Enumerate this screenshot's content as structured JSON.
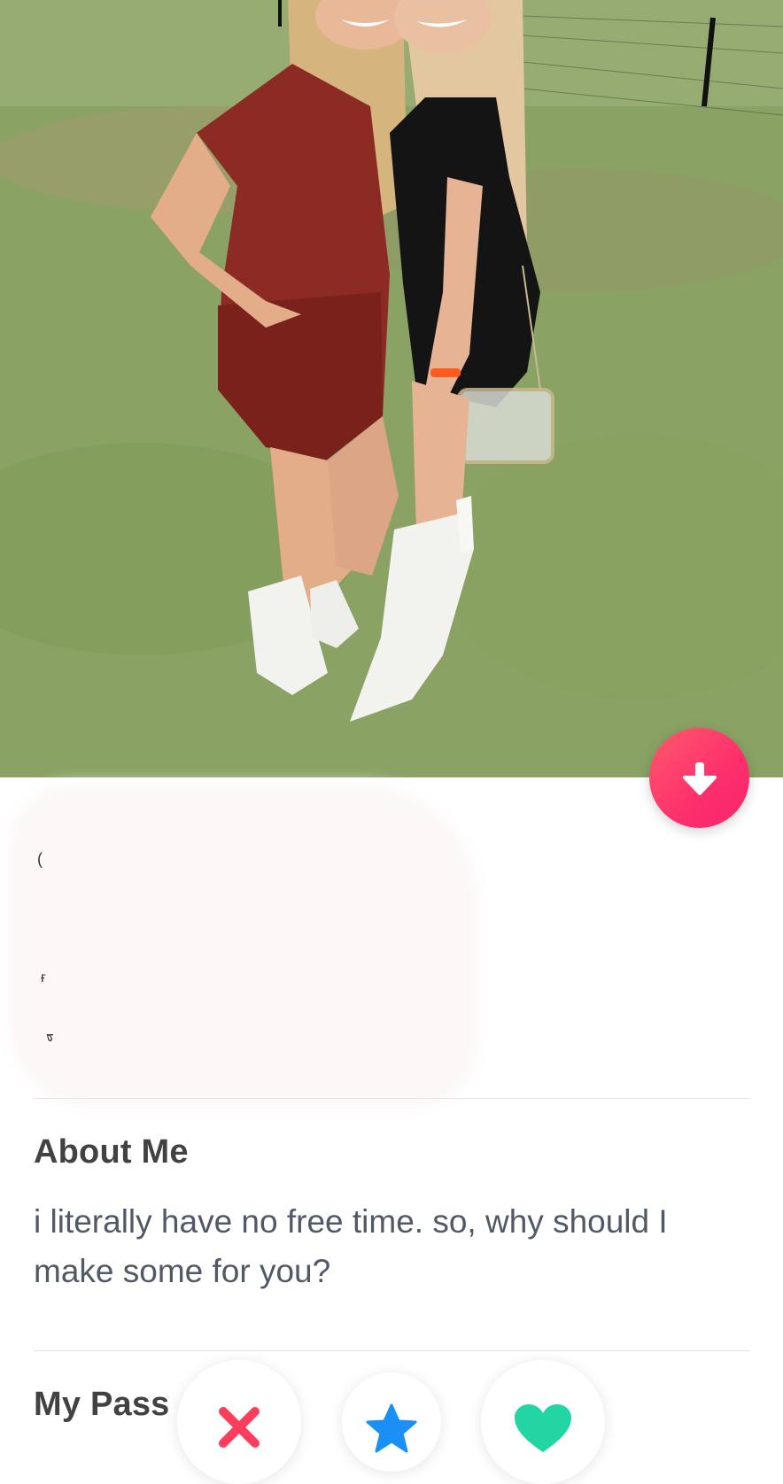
{
  "profile_photo": {
    "description_icon": "profile-photo",
    "accent_colors": {
      "outfit_left": "#8c2a24",
      "outfit_right": "#141414",
      "boots": "#f2f2ef",
      "grass": "#8aa264"
    }
  },
  "collapse_button": {
    "icon": "arrow-down-icon",
    "color": "#fd2f6c"
  },
  "about": {
    "title": "About Me",
    "text": "i literally have no free time. so, why should I make some for you?"
  },
  "passions": {
    "title": "My Pass"
  },
  "actions": {
    "nope": {
      "icon": "x-icon",
      "color": "#fe3d5c"
    },
    "super_like": {
      "icon": "star-icon",
      "color": "#1a8ff5"
    },
    "like": {
      "icon": "heart-icon",
      "color": "#21d6a2"
    }
  }
}
